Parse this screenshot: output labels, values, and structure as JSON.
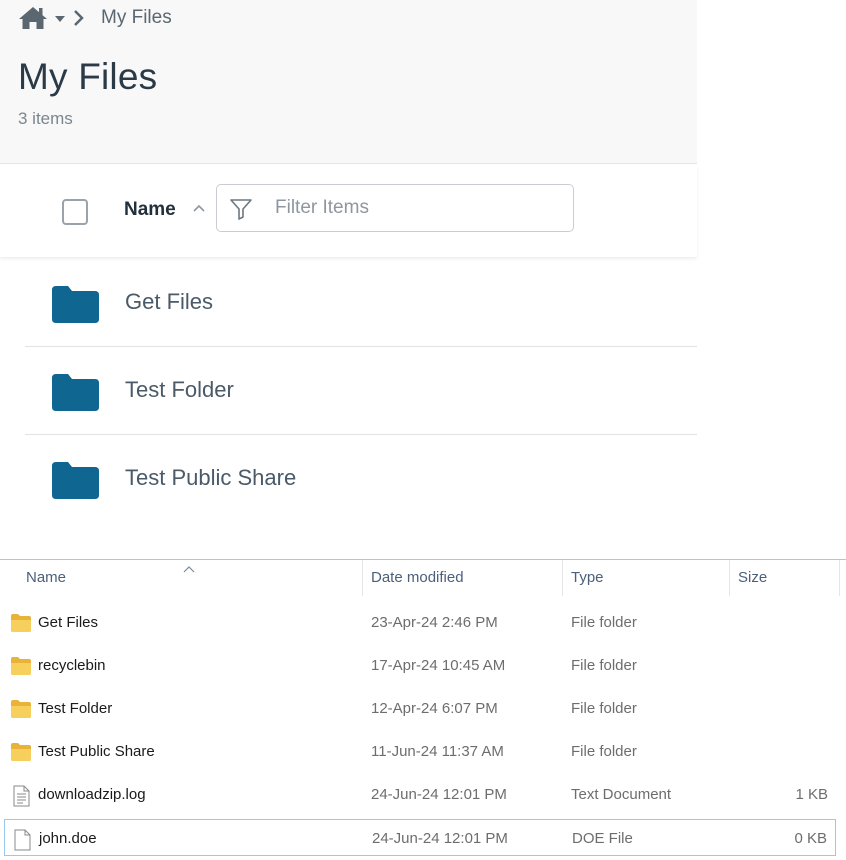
{
  "web": {
    "breadcrumb": {
      "current": "My Files"
    },
    "title": "My Files",
    "item_count": "3 items",
    "toolbar": {
      "name_header": "Name",
      "filter_placeholder": "Filter Items"
    },
    "items": [
      {
        "label": "Get Files"
      },
      {
        "label": "Test Folder"
      },
      {
        "label": "Test Public Share"
      }
    ],
    "colors": {
      "folder": "#0f6690",
      "text": "#4a5a68"
    }
  },
  "explorer": {
    "columns": {
      "name": "Name",
      "date": "Date modified",
      "type": "Type",
      "size": "Size"
    },
    "rows": [
      {
        "name": "Get Files",
        "date": "23-Apr-24 2:46 PM",
        "type": "File folder",
        "size": "",
        "icon": "folder-icon"
      },
      {
        "name": "recyclebin",
        "date": "17-Apr-24 10:45 AM",
        "type": "File folder",
        "size": "",
        "icon": "folder-icon"
      },
      {
        "name": "Test Folder",
        "date": "12-Apr-24 6:07 PM",
        "type": "File folder",
        "size": "",
        "icon": "folder-icon"
      },
      {
        "name": "Test Public Share",
        "date": "11-Jun-24 11:37 AM",
        "type": "File folder",
        "size": "",
        "icon": "folder-icon"
      },
      {
        "name": "downloadzip.log",
        "date": "24-Jun-24 12:01 PM",
        "type": "Text Document",
        "size": "1 KB",
        "icon": "text-file-icon"
      },
      {
        "name": "john.doe",
        "date": "24-Jun-24 12:01 PM",
        "type": "DOE File",
        "size": "0 KB",
        "icon": "file-icon"
      }
    ],
    "colors": {
      "folder": "#f2c24a",
      "selection_border": "#99c9ef"
    }
  }
}
